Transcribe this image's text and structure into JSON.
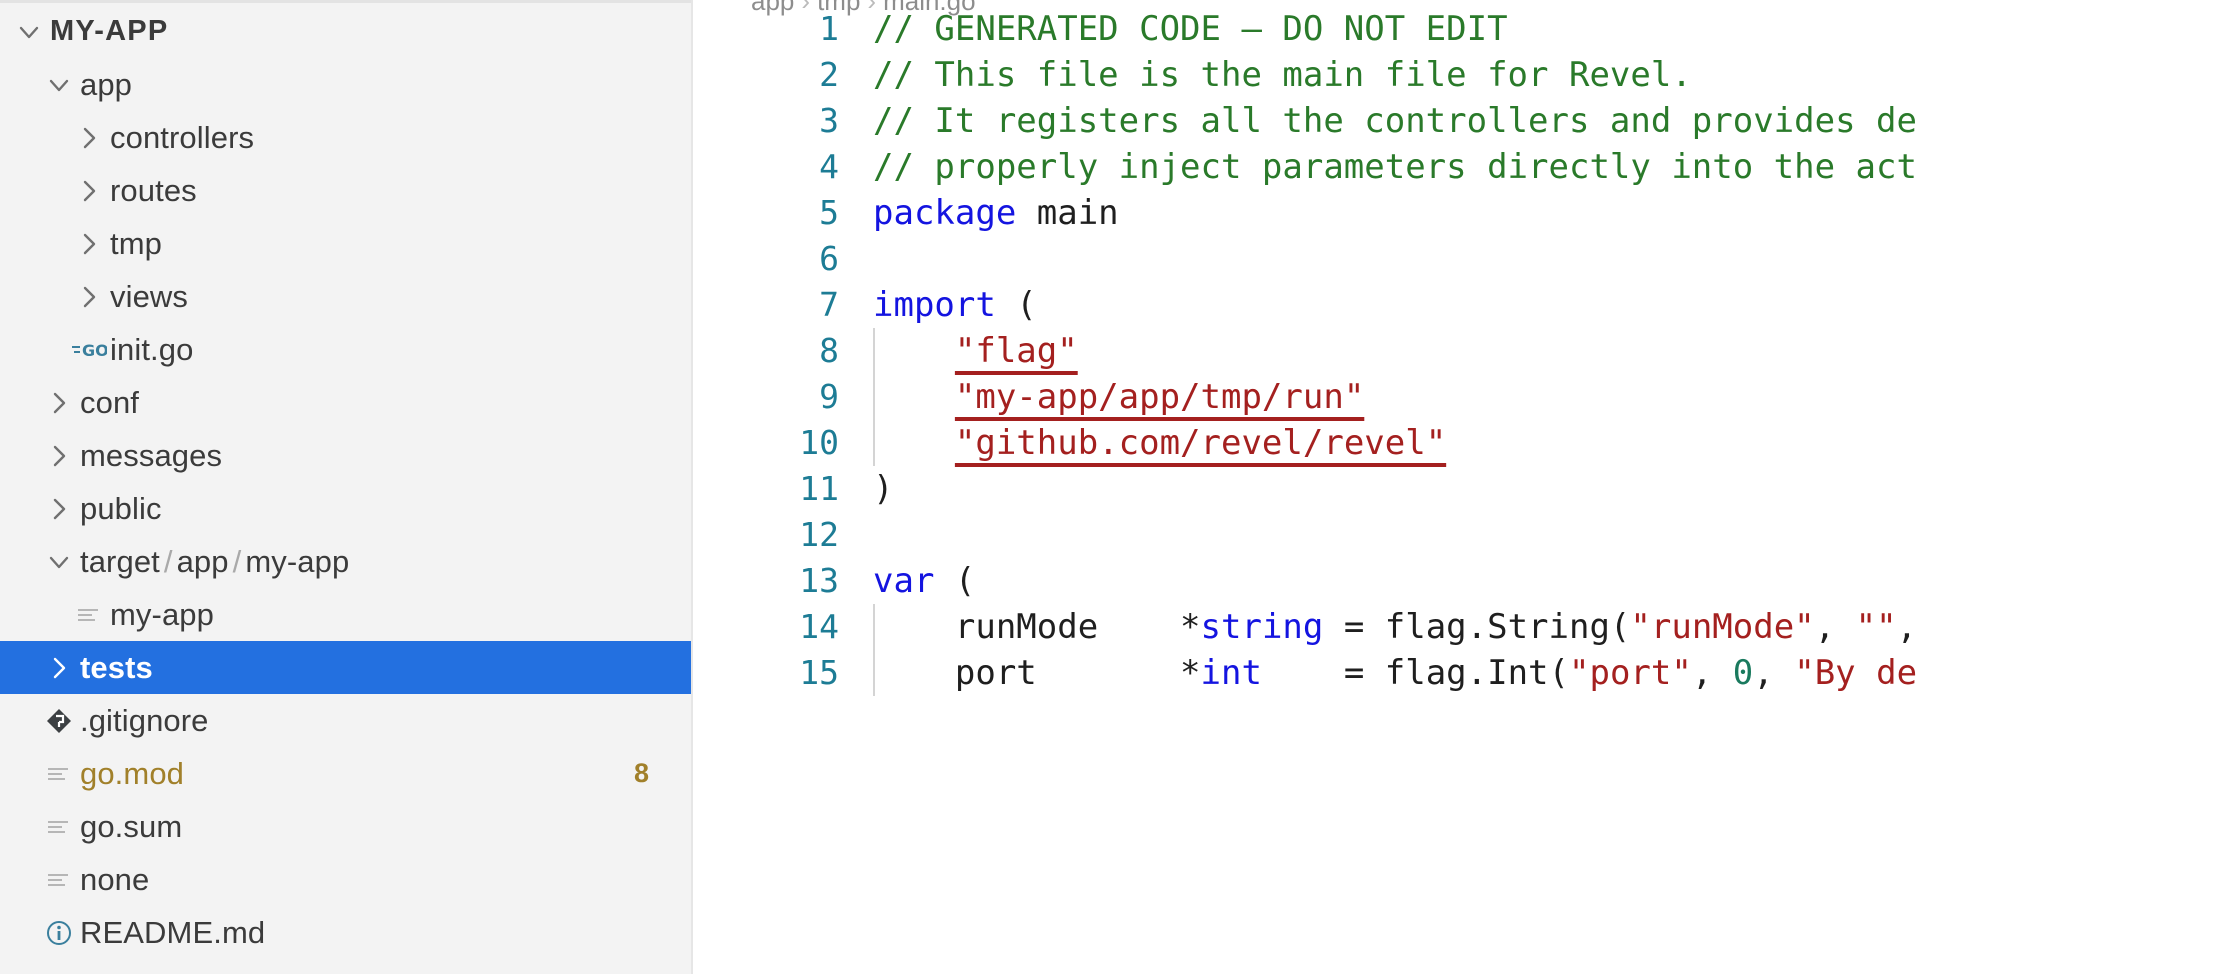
{
  "sidebar": {
    "root": {
      "label": "MY-APP",
      "expanded": true
    },
    "items": [
      {
        "label": "MY-APP",
        "kind": "folder",
        "indent": 0,
        "expanded": true,
        "icon": "chevron-down-icon",
        "root": true,
        "selected": false
      },
      {
        "label": "app",
        "kind": "folder",
        "indent": 1,
        "expanded": true,
        "icon": "chevron-down-icon",
        "selected": false
      },
      {
        "label": "controllers",
        "kind": "folder",
        "indent": 2,
        "expanded": false,
        "icon": "chevron-right-icon",
        "selected": false
      },
      {
        "label": "routes",
        "kind": "folder",
        "indent": 2,
        "expanded": false,
        "icon": "chevron-right-icon",
        "selected": false
      },
      {
        "label": "tmp",
        "kind": "folder",
        "indent": 2,
        "expanded": false,
        "icon": "chevron-right-icon",
        "selected": false
      },
      {
        "label": "views",
        "kind": "folder",
        "indent": 2,
        "expanded": false,
        "icon": "chevron-right-icon",
        "selected": false
      },
      {
        "label": "init.go",
        "kind": "file",
        "indent": 2,
        "icon": "go-file-icon",
        "selected": false
      },
      {
        "label": "conf",
        "kind": "folder",
        "indent": 1,
        "expanded": false,
        "icon": "chevron-right-icon",
        "selected": false
      },
      {
        "label": "messages",
        "kind": "folder",
        "indent": 1,
        "expanded": false,
        "icon": "chevron-right-icon",
        "selected": false
      },
      {
        "label": "public",
        "kind": "folder",
        "indent": 1,
        "expanded": false,
        "icon": "chevron-right-icon",
        "selected": false
      },
      {
        "label": "target / app / my-app",
        "kind": "folder",
        "indent": 1,
        "expanded": true,
        "icon": "chevron-down-icon",
        "compound": true,
        "selected": false
      },
      {
        "label": "my-app",
        "kind": "file",
        "indent": 2,
        "icon": "generic-file-icon",
        "selected": false
      },
      {
        "label": "tests",
        "kind": "folder",
        "indent": 1,
        "expanded": false,
        "icon": "chevron-right-icon",
        "selected": true
      },
      {
        "label": ".gitignore",
        "kind": "file",
        "indent": 1,
        "icon": "git-file-icon",
        "selected": false
      },
      {
        "label": "go.mod",
        "kind": "file",
        "indent": 1,
        "icon": "generic-file-icon",
        "modified": true,
        "badge": "8",
        "selected": false
      },
      {
        "label": "go.sum",
        "kind": "file",
        "indent": 1,
        "icon": "generic-file-icon",
        "selected": false
      },
      {
        "label": "none",
        "kind": "file",
        "indent": 1,
        "icon": "generic-file-icon",
        "selected": false
      },
      {
        "label": "README.md",
        "kind": "file",
        "indent": 1,
        "icon": "info-file-icon",
        "selected": false
      }
    ]
  },
  "editor": {
    "breadcrumb": [
      "app",
      "tmp",
      "main.go"
    ],
    "colors": {
      "comment": "#2a7a2a",
      "keyword": "#1414e0",
      "string": "#a4201f",
      "number": "#1a7a5e",
      "line_number": "#1d7c95",
      "selection": "#2370e0",
      "modified_file": "#a1802a"
    },
    "lines": [
      {
        "n": "1",
        "guide": false,
        "tokens": [
          {
            "t": "// GENERATED CODE – DO NOT EDIT",
            "c": "comment"
          }
        ]
      },
      {
        "n": "2",
        "guide": false,
        "tokens": [
          {
            "t": "// This file is the main file for Revel.",
            "c": "comment"
          }
        ]
      },
      {
        "n": "3",
        "guide": false,
        "tokens": [
          {
            "t": "// It registers all the controllers and provides de",
            "c": "comment"
          }
        ]
      },
      {
        "n": "4",
        "guide": false,
        "tokens": [
          {
            "t": "// properly inject parameters directly into the act",
            "c": "comment"
          }
        ]
      },
      {
        "n": "5",
        "guide": false,
        "tokens": [
          {
            "t": "package",
            "c": "kw"
          },
          {
            "t": " main",
            "c": "plain"
          }
        ]
      },
      {
        "n": "6",
        "guide": false,
        "tokens": []
      },
      {
        "n": "7",
        "guide": false,
        "tokens": [
          {
            "t": "import",
            "c": "kw"
          },
          {
            "t": " (",
            "c": "punct"
          }
        ]
      },
      {
        "n": "8",
        "guide": true,
        "tokens": [
          {
            "t": "    ",
            "c": "plain"
          },
          {
            "t": "\"flag\"",
            "c": "strerr"
          }
        ]
      },
      {
        "n": "9",
        "guide": true,
        "tokens": [
          {
            "t": "    ",
            "c": "plain"
          },
          {
            "t": "\"my-app/app/tmp/run\"",
            "c": "strerr"
          }
        ]
      },
      {
        "n": "10",
        "guide": true,
        "tokens": [
          {
            "t": "    ",
            "c": "plain"
          },
          {
            "t": "\"github.com/revel/revel\"",
            "c": "strerr"
          }
        ]
      },
      {
        "n": "11",
        "guide": false,
        "tokens": [
          {
            "t": ")",
            "c": "punct"
          }
        ]
      },
      {
        "n": "12",
        "guide": false,
        "tokens": []
      },
      {
        "n": "13",
        "guide": false,
        "tokens": [
          {
            "t": "var",
            "c": "kw"
          },
          {
            "t": " (",
            "c": "punct"
          }
        ]
      },
      {
        "n": "14",
        "guide": true,
        "tokens": [
          {
            "t": "    runMode    ",
            "c": "plain"
          },
          {
            "t": "*",
            "c": "punct"
          },
          {
            "t": "string",
            "c": "type"
          },
          {
            "t": " = flag.String(",
            "c": "plain"
          },
          {
            "t": "\"runMode\"",
            "c": "str"
          },
          {
            "t": ", ",
            "c": "plain"
          },
          {
            "t": "\"\"",
            "c": "str"
          },
          {
            "t": ",",
            "c": "plain"
          }
        ]
      },
      {
        "n": "15",
        "guide": true,
        "tokens": [
          {
            "t": "    port       ",
            "c": "plain"
          },
          {
            "t": "*",
            "c": "punct"
          },
          {
            "t": "int",
            "c": "type"
          },
          {
            "t": "    = flag.Int(",
            "c": "plain"
          },
          {
            "t": "\"port\"",
            "c": "str"
          },
          {
            "t": ", ",
            "c": "plain"
          },
          {
            "t": "0",
            "c": "num"
          },
          {
            "t": ", ",
            "c": "plain"
          },
          {
            "t": "\"By de",
            "c": "str"
          }
        ]
      }
    ]
  }
}
